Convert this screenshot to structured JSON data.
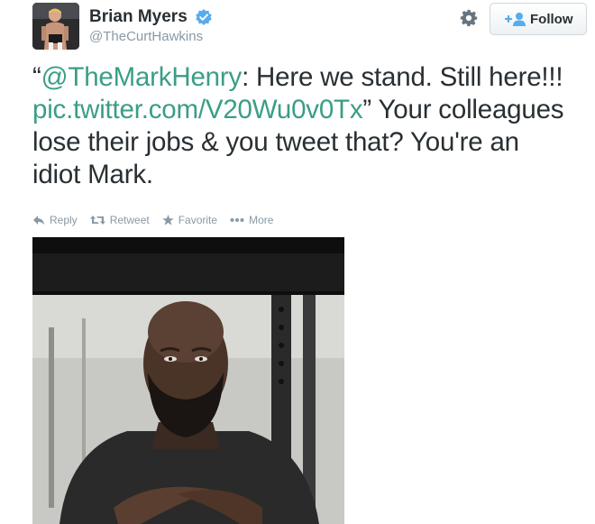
{
  "tweet": {
    "author_name": "Brian Myers",
    "author_handle": "@TheCurtHawkins",
    "follow_label": "Follow",
    "open_quote": "“",
    "mention": "@TheMarkHenry",
    "text_before_link": ": Here we stand. Still here!!! ",
    "link": "pic.twitter.com/V20Wu0v0Tx",
    "text_after_link": "” Your colleagues lose their jobs & you tweet that? You're an idiot Mark."
  },
  "actions": [
    {
      "label": "Reply",
      "icon": "reply-icon"
    },
    {
      "label": "Retweet",
      "icon": "retweet-icon"
    },
    {
      "label": "Favorite",
      "icon": "star-icon"
    },
    {
      "label": "More",
      "icon": "more-dots-icon"
    }
  ],
  "colors": {
    "link": "#3a9e86",
    "verified": "#55acee",
    "muted": "#8899a6",
    "text": "#292f33"
  },
  "icons": {
    "gear": "gear-icon",
    "follow": "follow-person-icon",
    "verified": "verified-badge-icon"
  }
}
